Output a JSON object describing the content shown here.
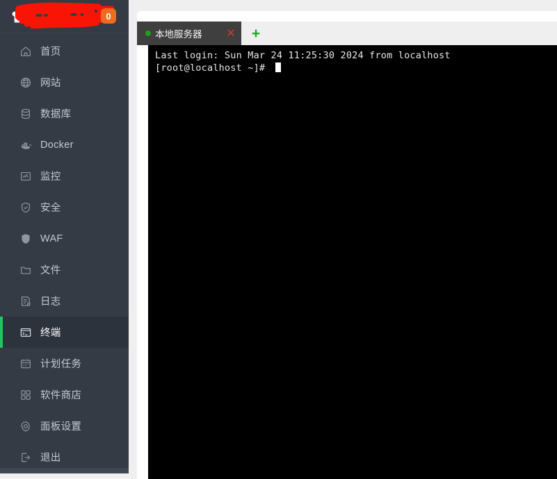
{
  "sidebar": {
    "brand": {
      "logo_icon": "chef-hat-logo-icon",
      "title": "",
      "redacted": true,
      "badge_count": "0",
      "badge_color": "#ee6c20"
    },
    "items": [
      {
        "label": "首页",
        "icon": "home-icon",
        "active": false
      },
      {
        "label": "网站",
        "icon": "globe-icon",
        "active": false
      },
      {
        "label": "数据库",
        "icon": "database-icon",
        "active": false
      },
      {
        "label": "Docker",
        "icon": "docker-icon",
        "active": false
      },
      {
        "label": "监控",
        "icon": "monitor-icon",
        "active": false
      },
      {
        "label": "安全",
        "icon": "shield-check-icon",
        "active": false
      },
      {
        "label": "WAF",
        "icon": "shield-solid-icon",
        "active": false
      },
      {
        "label": "文件",
        "icon": "folder-icon",
        "active": false
      },
      {
        "label": "日志",
        "icon": "log-icon",
        "active": false
      },
      {
        "label": "终端",
        "icon": "terminal-icon",
        "active": true
      },
      {
        "label": "计划任务",
        "icon": "calendar-icon",
        "active": false
      },
      {
        "label": "软件商店",
        "icon": "grid-apps-icon",
        "active": false
      },
      {
        "label": "面板设置",
        "icon": "gear-icon",
        "active": false
      },
      {
        "label": "退出",
        "icon": "logout-icon",
        "active": false
      }
    ],
    "active_accent": "#20c55e",
    "background": "#343b45"
  },
  "main": {
    "tabs": [
      {
        "title": "本地服务器",
        "status_dot": "connected-dot",
        "status_color": "#19a319",
        "close_label": "✕",
        "active": true
      }
    ],
    "add_tab_label": "+",
    "terminal": {
      "lines": [
        "Last login: Sun Mar 24 11:25:30 2024 from localhost",
        "[root@localhost ~]# "
      ],
      "line1": "Last login: Sun Mar 24 11:25:30 2024 from localhost",
      "line2": "[root@localhost ~]# ",
      "background": "#000000",
      "foreground": "#e6e6e6",
      "cursor_visible": true
    }
  }
}
